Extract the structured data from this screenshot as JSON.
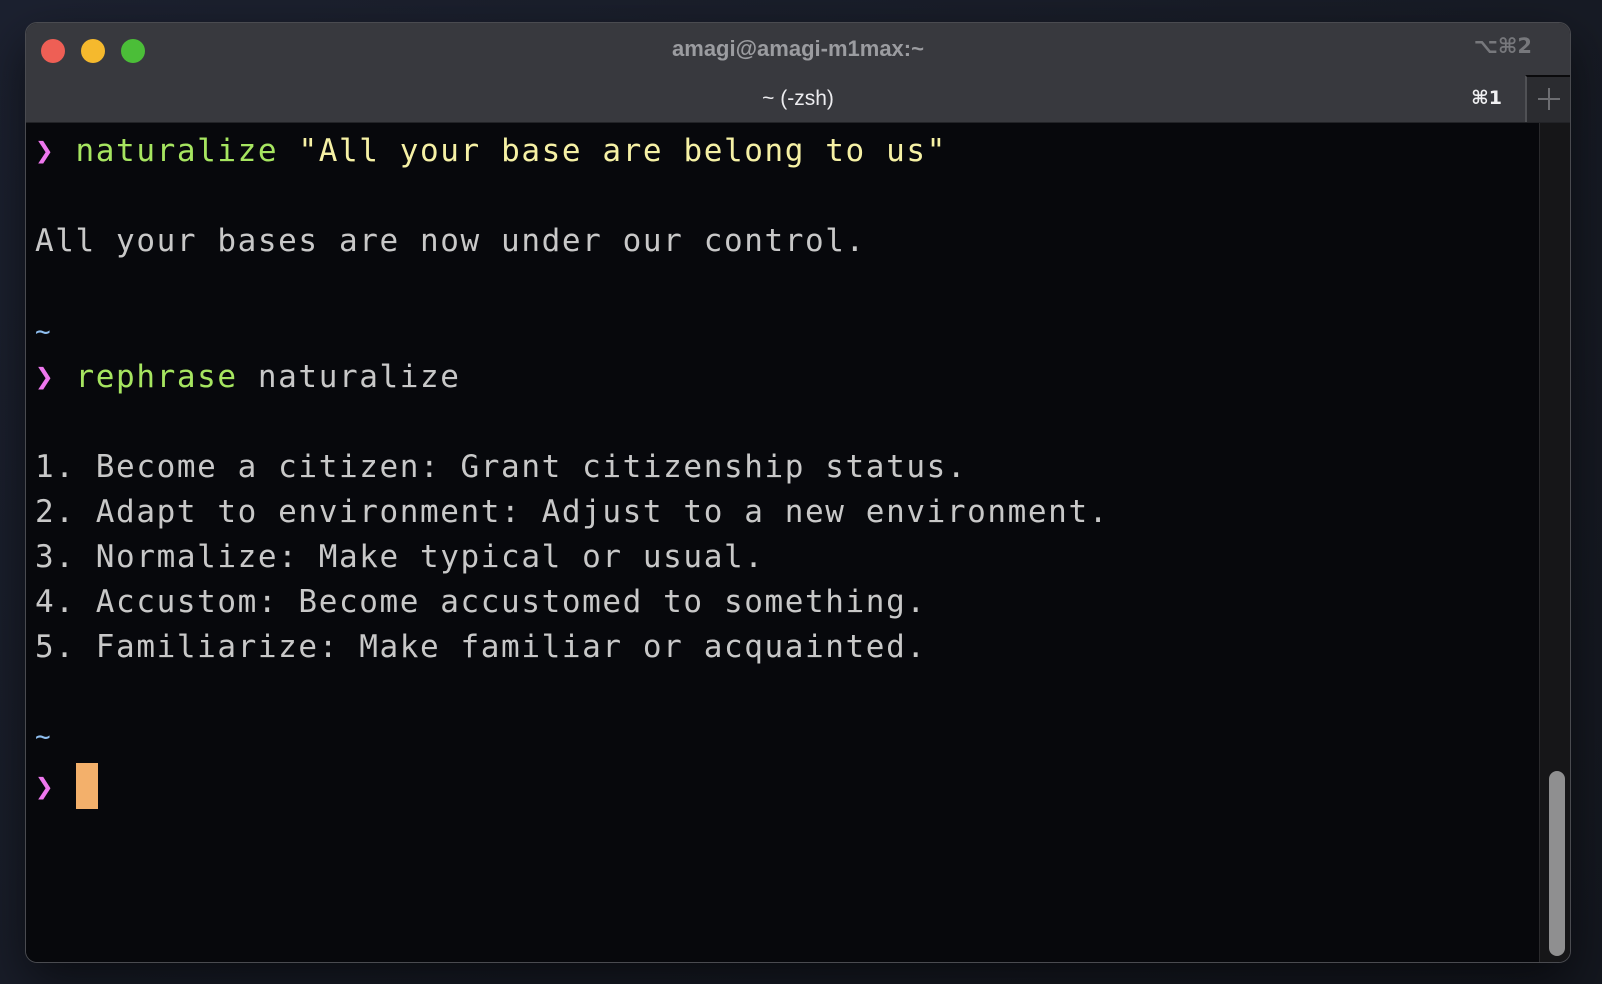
{
  "window": {
    "title": "amagi@amagi-m1max:~",
    "shortcut": "⌥⌘2"
  },
  "tabs": [
    {
      "title": "~ (-zsh)",
      "shortcut": "⌘1",
      "active": true
    }
  ],
  "new_tab_icon": "plus-icon",
  "terminal": {
    "prompt_symbol": "❯",
    "cwd_marker": "~",
    "session": [
      {
        "type": "command",
        "command": "naturalize",
        "args": "\"All your base are belong to us\""
      },
      {
        "type": "output",
        "text": "All your bases are now under our control."
      },
      {
        "type": "cwd",
        "text": "~"
      },
      {
        "type": "command",
        "command": "rephrase",
        "args": "naturalize"
      },
      {
        "type": "output_list",
        "items": [
          "1. Become a citizen: Grant citizenship status.",
          "2. Adapt to environment: Adjust to a new environment.",
          "3. Normalize: Make typical or usual.",
          "4. Accustom: Become accustomed to something.",
          "5. Familiarize: Make familiar or acquainted."
        ]
      },
      {
        "type": "cwd",
        "text": "~"
      },
      {
        "type": "prompt",
        "input": ""
      }
    ]
  },
  "scrollbar": {
    "visible_fraction": 0.22,
    "position": "bottom"
  },
  "colors": {
    "prompt": "#ee77ee",
    "command": "#a6e560",
    "string_arg": "#f6f1a5",
    "output": "#c8c8c8",
    "cwd": "#8fbff0",
    "cursor": "#f3b06b",
    "background": "#07080c"
  }
}
